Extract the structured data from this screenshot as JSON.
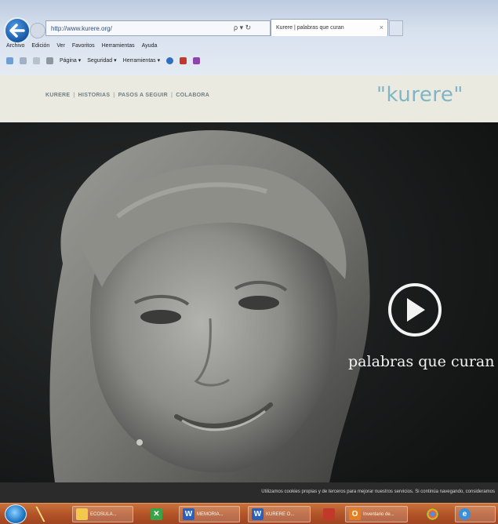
{
  "browser": {
    "address": "http://www.kurere.org/",
    "tab_title": "Kurere | palabras que curan",
    "menu": [
      "Archivo",
      "Edición",
      "Ver",
      "Favoritos",
      "Herramientas",
      "Ayuda"
    ],
    "commands": [
      "Página ▾",
      "Seguridad ▾",
      "Herramientas ▾"
    ],
    "addr_tools": "ρ ▾ ↻"
  },
  "site": {
    "nav": [
      "KURERE",
      "HISTORIAS",
      "PASOS A SEGUIR",
      "COLABORA"
    ],
    "logo": "\"kurere\"",
    "tagline": "palabras que curan",
    "cookie_notice": "Utilizamos cookies propias y de terceros para mejorar nuestros servicios. Si continúa navegando, consideramos"
  },
  "taskbar": {
    "items": [
      "",
      "",
      "ECOSULA...",
      "",
      "MEMORIA...",
      "KURERE O...",
      "",
      "Inventario de...",
      "",
      ""
    ]
  },
  "colors": {
    "logo": "#7fb5c4",
    "header_bg": "#ebeae1",
    "taskbar": "#b35528"
  }
}
